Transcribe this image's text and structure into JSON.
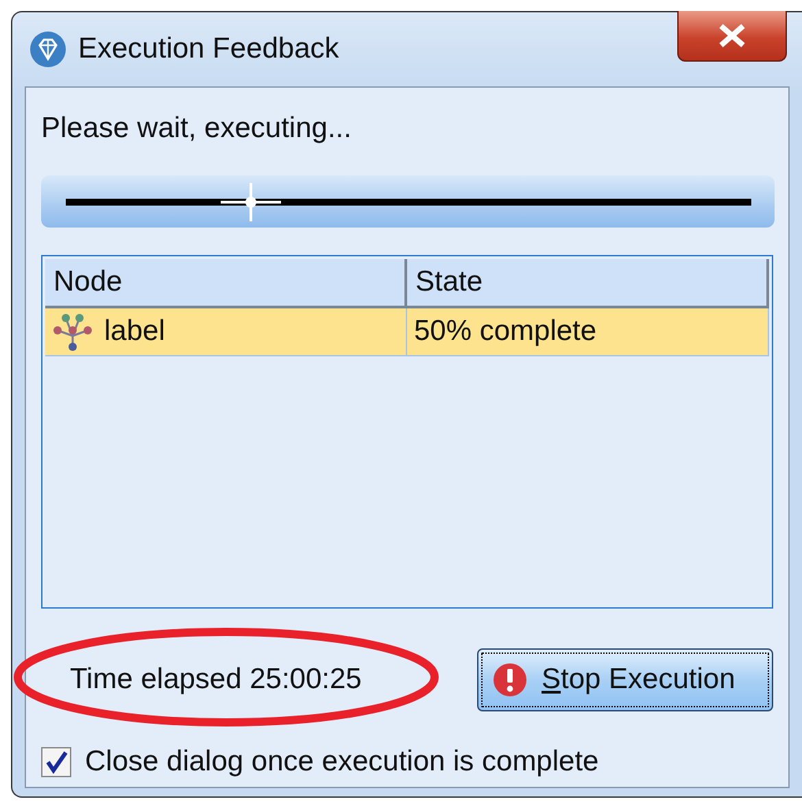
{
  "window": {
    "title": "Execution Feedback"
  },
  "message": "Please wait, executing...",
  "progress": {
    "level": 0.27
  },
  "table": {
    "columns": [
      "Node",
      "State"
    ],
    "rows": [
      {
        "node": "label",
        "state": "50% complete",
        "selected": true
      }
    ]
  },
  "elapsed": "Time elapsed 25:00:25",
  "stop_button": "Stop Execution",
  "close_checkbox": {
    "label": "Close dialog once execution is complete",
    "checked": true
  }
}
